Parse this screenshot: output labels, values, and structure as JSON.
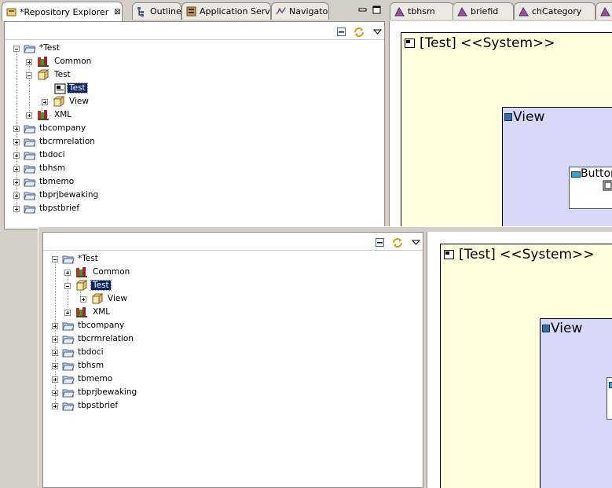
{
  "top": {
    "view_tabs": [
      {
        "label": "*Repository Explorer",
        "close": "⊠"
      },
      {
        "label": "Outline"
      },
      {
        "label": "Application Server"
      },
      {
        "label": "Navigator"
      }
    ],
    "editor_tabs": [
      {
        "label": "tbhsm"
      },
      {
        "label": "briefid"
      },
      {
        "label": "chCategory"
      }
    ],
    "tree": [
      {
        "label": "*Test"
      },
      {
        "label": "Common"
      },
      {
        "label": "Test"
      },
      {
        "label": "Test"
      },
      {
        "label": "View"
      },
      {
        "label": "XML"
      },
      {
        "label": "tbcompany"
      },
      {
        "label": "tbcrmrelation"
      },
      {
        "label": "tbdoci"
      },
      {
        "label": "tbhsm"
      },
      {
        "label": "tbmemo"
      },
      {
        "label": "tbprjbewaking"
      },
      {
        "label": "tbpstbrief"
      }
    ],
    "diagram": {
      "system_title": "[Test] <<System>>",
      "view_title": "View",
      "button_title": "Button"
    }
  },
  "bottom": {
    "tree": [
      {
        "label": "*Test"
      },
      {
        "label": "Common"
      },
      {
        "label": "Test"
      },
      {
        "label": "View"
      },
      {
        "label": "XML"
      },
      {
        "label": "tbcompany"
      },
      {
        "label": "tbcrmrelation"
      },
      {
        "label": "tbdoci"
      },
      {
        "label": "tbhsm"
      },
      {
        "label": "tbmemo"
      },
      {
        "label": "tbprjbewaking"
      },
      {
        "label": "tbpstbrief"
      }
    ],
    "diagram": {
      "system_title": "[Test] <<System>>",
      "view_title": "View"
    }
  },
  "colors": {
    "selection": "#0a246a",
    "system_fill": "#ffffde",
    "view_fill": "#d8d8f8",
    "chrome": "#d4d0c8"
  },
  "icons": {
    "collapse_all": "collapse-all-icon",
    "link_with_editor": "link-with-editor-icon",
    "view_menu": "view-menu-icon",
    "minimize": "minimize-icon",
    "maximize": "maximize-icon"
  }
}
